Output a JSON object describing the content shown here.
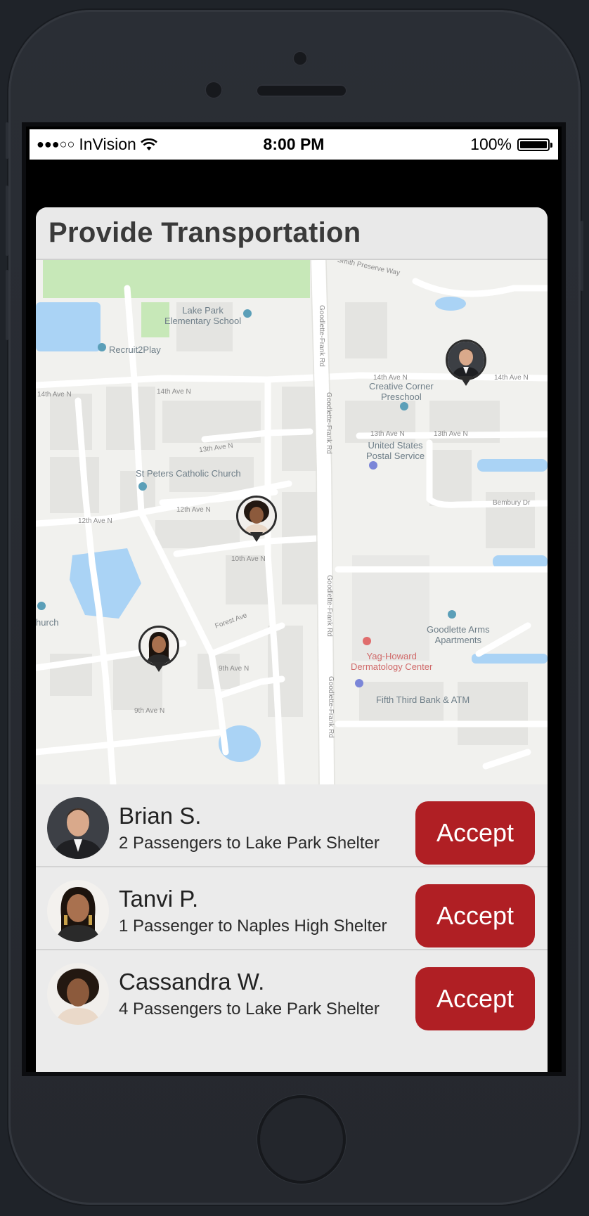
{
  "status_bar": {
    "signal_dots": "●●●○○",
    "carrier": "InVision",
    "wifi_icon": "wifi-icon",
    "time": "8:00 PM",
    "battery_percent": "100%",
    "battery_level": 1.0
  },
  "screen": {
    "title": "Provide Transportation"
  },
  "map": {
    "streets": {
      "a": "14th Ave N",
      "b": "14th Ave N",
      "c": "13th Ave N",
      "d": "12th Ave N",
      "e": "12th Ave N",
      "f": "10th Ave N",
      "g": "9th Ave N",
      "h": "9th Ave N",
      "i": "Goodlette-Frank Rd",
      "j": "Goodlette-Frank Rd",
      "k": "Goodlette-Frank Rd",
      "l": "Goodlette-Frank Rd",
      "m": "13th Ave N",
      "n": "13th Ave N",
      "o": "14th Ave N",
      "p": "14th Ave N",
      "q": "Bembury Dr",
      "r": "Smith Preserve Way",
      "s": "Forest Ave"
    },
    "places": {
      "school": "Lake Park\nElementary School",
      "recruit": "Recruit2Play",
      "church": "St Peters Catholic Church",
      "preschool": "Creative Corner\nPreschool",
      "postal": "United States\nPostal Service",
      "apartments": "Goodlette Arms\nApartments",
      "dermatology": "Yag-Howard\nDermatology Center",
      "bank": "Fifth Third Bank & ATM",
      "church_partial": "hurch"
    }
  },
  "requests": [
    {
      "name": "Brian S.",
      "detail": "2 Passengers to Lake Park Shelter",
      "action": "Accept"
    },
    {
      "name": "Tanvi P.",
      "detail": "1 Passenger to Naples High Shelter",
      "action": "Accept"
    },
    {
      "name": "Cassandra W.",
      "detail": "4 Passengers to Lake Park Shelter",
      "action": "Accept"
    }
  ],
  "colors": {
    "accept": "#b01f24",
    "water": "#aad3f5",
    "park": "#c7e8b8"
  }
}
